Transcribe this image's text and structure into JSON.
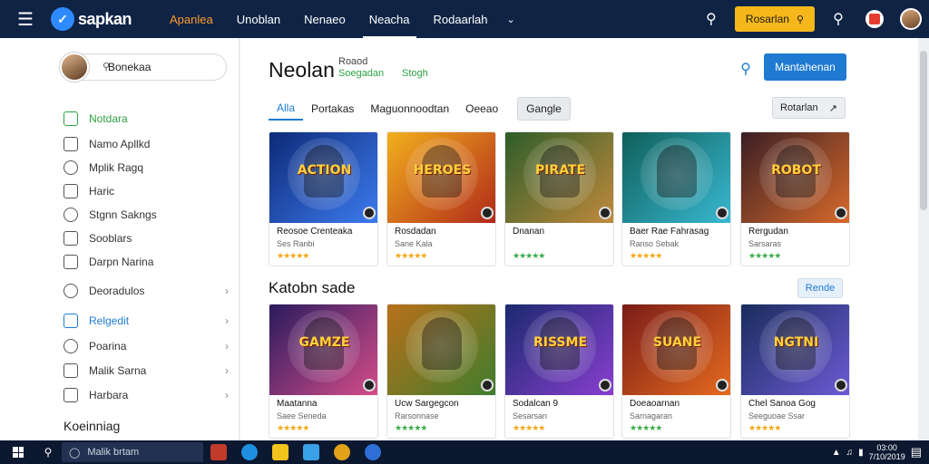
{
  "topbar": {
    "logo_text": "sapkan",
    "nav": [
      "Apanlea",
      "Unoblan",
      "Nenaeo",
      "Neacha",
      "Rodaarlah"
    ],
    "cta_label": "Rosarlan",
    "cta_icon": "key-icon"
  },
  "sidebar": {
    "search_value": "Bonekaa",
    "items": [
      {
        "label": "Notdara",
        "icon": "home-icon"
      },
      {
        "label": "Namo Apllkd",
        "icon": "folder-icon"
      },
      {
        "label": "Mplik Ragq",
        "icon": "search-icon"
      },
      {
        "label": "Haric",
        "icon": "bookmark-icon"
      },
      {
        "label": "Stgnn Sakngs",
        "icon": "bell-icon"
      },
      {
        "label": "Sooblars",
        "icon": "grid-icon"
      },
      {
        "label": "Darpn Narina",
        "icon": "chart-icon"
      },
      {
        "label": "Deoradulos",
        "icon": "clock-icon"
      },
      {
        "label": "Relgedit",
        "icon": "square-icon"
      },
      {
        "label": "Poarina",
        "icon": "info-icon"
      },
      {
        "label": "Malik Sarna",
        "icon": "house-icon"
      },
      {
        "label": "Harbara",
        "icon": "card-icon"
      }
    ],
    "footer": "Koeinniag"
  },
  "main": {
    "title": "Neolan",
    "meta_line1": "Roaod",
    "meta_line2": "Soegadan",
    "meta_green": "Stogh",
    "primary_button": "Mantahenan",
    "tabs": [
      "Alla",
      "Portakas",
      "Maguonnoodtan",
      "Oeeao",
      "Gangle"
    ],
    "sort_label": "Rotarlan",
    "section_title": "Katobn sade",
    "section_button": "Rende",
    "row1": [
      {
        "art_text": "ACTION",
        "name": "Reosoe Crenteaka",
        "sub": "Ses Ranbi",
        "colors": [
          "#0d2a78",
          "#3d7cf0"
        ],
        "stars": "gold"
      },
      {
        "art_text": "HEROES",
        "name": "Rosdadan",
        "sub": "Sane Kala",
        "colors": [
          "#f2b01d",
          "#b0281a"
        ],
        "stars": "gold"
      },
      {
        "art_text": "PIRATE",
        "name": "Dnanan",
        "sub": "",
        "colors": [
          "#2d5d2a",
          "#c28a3c"
        ],
        "stars": "green"
      },
      {
        "art_text": "",
        "name": "Baer Rae Fahrasag",
        "sub": "Ranso Sebak",
        "colors": [
          "#0f5f5a",
          "#39b9d2"
        ],
        "stars": "gold"
      },
      {
        "art_text": "ROBOT",
        "name": "Rergudan",
        "sub": "Sarsaras",
        "colors": [
          "#3a1f24",
          "#d96a2b"
        ],
        "stars": "green"
      }
    ],
    "row2": [
      {
        "art_text": "GAMZE",
        "name": "Maatanna",
        "sub": "Saee Seneda",
        "colors": [
          "#2a1b5e",
          "#d64d8a"
        ],
        "stars": "gold"
      },
      {
        "art_text": "",
        "name": "Ucw Sargegcon",
        "sub": "Rarsonnase",
        "colors": [
          "#b8701a",
          "#3e7d2d"
        ],
        "stars": "green"
      },
      {
        "art_text": "RISSME",
        "name": "Sodalcan 9",
        "sub": "Sesarsan",
        "colors": [
          "#1a2a6e",
          "#8a3fd1"
        ],
        "stars": "gold"
      },
      {
        "art_text": "SUANE",
        "name": "Doeaoarnan",
        "sub": "Sarnagaran",
        "colors": [
          "#7a1c17",
          "#e66b1f"
        ],
        "stars": "green"
      },
      {
        "art_text": "NGTNI",
        "name": "Chel Sanoa Gog",
        "sub": "Seeguoae Ssar",
        "colors": [
          "#1a2c5c",
          "#6c5bd6"
        ],
        "stars": "gold"
      }
    ]
  },
  "taskbar": {
    "search_placeholder": "Malik brtam",
    "time": "03:00",
    "date": "7/10/2019"
  }
}
